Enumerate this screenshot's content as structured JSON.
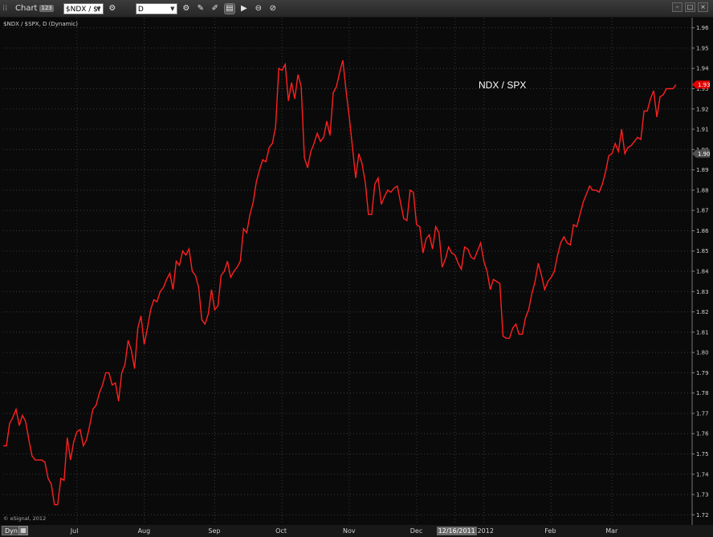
{
  "toolbar": {
    "chart_label": "Chart",
    "chart_badge": "123",
    "symbol_value": "$NDX / $!",
    "interval_value": "D"
  },
  "legend_text": "$NDX / $SPX, D (Dynamic)",
  "copyright": "© eSignal, 2012",
  "bottom": {
    "dyn_label": "Dyn"
  },
  "colors": {
    "line": "#ff2020",
    "background": "#0a0a0a",
    "grid": "#3a3a3a",
    "text": "#d0d0d0",
    "price_tag": "#e00000",
    "cursor_tag": "#505050"
  },
  "chart_data": {
    "type": "line",
    "title": "NDX / SPX",
    "xlabel": "",
    "ylabel": "",
    "ylim": [
      1.715,
      1.965
    ],
    "y_ticks": [
      1.72,
      1.73,
      1.74,
      1.75,
      1.76,
      1.77,
      1.78,
      1.79,
      1.8,
      1.81,
      1.82,
      1.83,
      1.84,
      1.85,
      1.86,
      1.87,
      1.88,
      1.89,
      1.9,
      1.91,
      1.92,
      1.93,
      1.94,
      1.95,
      1.96
    ],
    "x_ticks": [
      {
        "label": "Jul",
        "index": 23
      },
      {
        "label": "Aug",
        "index": 44
      },
      {
        "label": "Sep",
        "index": 66
      },
      {
        "label": "Oct",
        "index": 87
      },
      {
        "label": "Nov",
        "index": 108
      },
      {
        "label": "Dec",
        "index": 129
      },
      {
        "label": "12/16/2011",
        "index": 141,
        "highlight": true
      },
      {
        "label": "2012",
        "index": 150
      },
      {
        "label": "Feb",
        "index": 171
      },
      {
        "label": "Mar",
        "index": 190
      }
    ],
    "last_value_tag": "1.93",
    "cursor_value_tag": "1.90",
    "cursor_value": 1.898,
    "series": [
      {
        "values": [
          1.754,
          1.754,
          1.765,
          1.768,
          1.772,
          1.764,
          1.769,
          1.766,
          1.757,
          1.749,
          1.747,
          1.747,
          1.747,
          1.746,
          1.738,
          1.735,
          1.725,
          1.725,
          1.738,
          1.737,
          1.758,
          1.747,
          1.756,
          1.761,
          1.762,
          1.754,
          1.757,
          1.764,
          1.772,
          1.774,
          1.78,
          1.784,
          1.79,
          1.79,
          1.784,
          1.785,
          1.776,
          1.79,
          1.794,
          1.806,
          1.801,
          1.792,
          1.812,
          1.818,
          1.804,
          1.812,
          1.821,
          1.826,
          1.825,
          1.83,
          1.832,
          1.836,
          1.839,
          1.831,
          1.845,
          1.843,
          1.85,
          1.848,
          1.851,
          1.84,
          1.838,
          1.832,
          1.816,
          1.814,
          1.819,
          1.831,
          1.821,
          1.823,
          1.838,
          1.84,
          1.845,
          1.837,
          1.84,
          1.842,
          1.845,
          1.861,
          1.859,
          1.868,
          1.874,
          1.884,
          1.89,
          1.895,
          1.894,
          1.901,
          1.903,
          1.911,
          1.94,
          1.939,
          1.942,
          1.924,
          1.933,
          1.925,
          1.937,
          1.931,
          1.896,
          1.891,
          1.899,
          1.903,
          1.908,
          1.904,
          1.906,
          1.914,
          1.907,
          1.928,
          1.931,
          1.938,
          1.944,
          1.929,
          1.916,
          1.901,
          1.886,
          1.898,
          1.893,
          1.884,
          1.868,
          1.868,
          1.883,
          1.886,
          1.873,
          1.877,
          1.88,
          1.879,
          1.881,
          1.882,
          1.874,
          1.866,
          1.865,
          1.88,
          1.879,
          1.863,
          1.862,
          1.849,
          1.856,
          1.858,
          1.851,
          1.862,
          1.859,
          1.842,
          1.846,
          1.852,
          1.849,
          1.848,
          1.844,
          1.841,
          1.852,
          1.851,
          1.847,
          1.846,
          1.85,
          1.854,
          1.845,
          1.84,
          1.831,
          1.836,
          1.835,
          1.834,
          1.808,
          1.807,
          1.807,
          1.812,
          1.814,
          1.809,
          1.809,
          1.817,
          1.821,
          1.829,
          1.835,
          1.844,
          1.838,
          1.831,
          1.835,
          1.837,
          1.84,
          1.848,
          1.854,
          1.857,
          1.854,
          1.853,
          1.863,
          1.862,
          1.868,
          1.874,
          1.878,
          1.882,
          1.88,
          1.88,
          1.879,
          1.883,
          1.889,
          1.897,
          1.898,
          1.903,
          1.899,
          1.91,
          1.898,
          1.901,
          1.902,
          1.904,
          1.906,
          1.905,
          1.919,
          1.919,
          1.925,
          1.929,
          1.916,
          1.926,
          1.927,
          1.93,
          1.93,
          1.93,
          1.932
        ]
      }
    ]
  }
}
